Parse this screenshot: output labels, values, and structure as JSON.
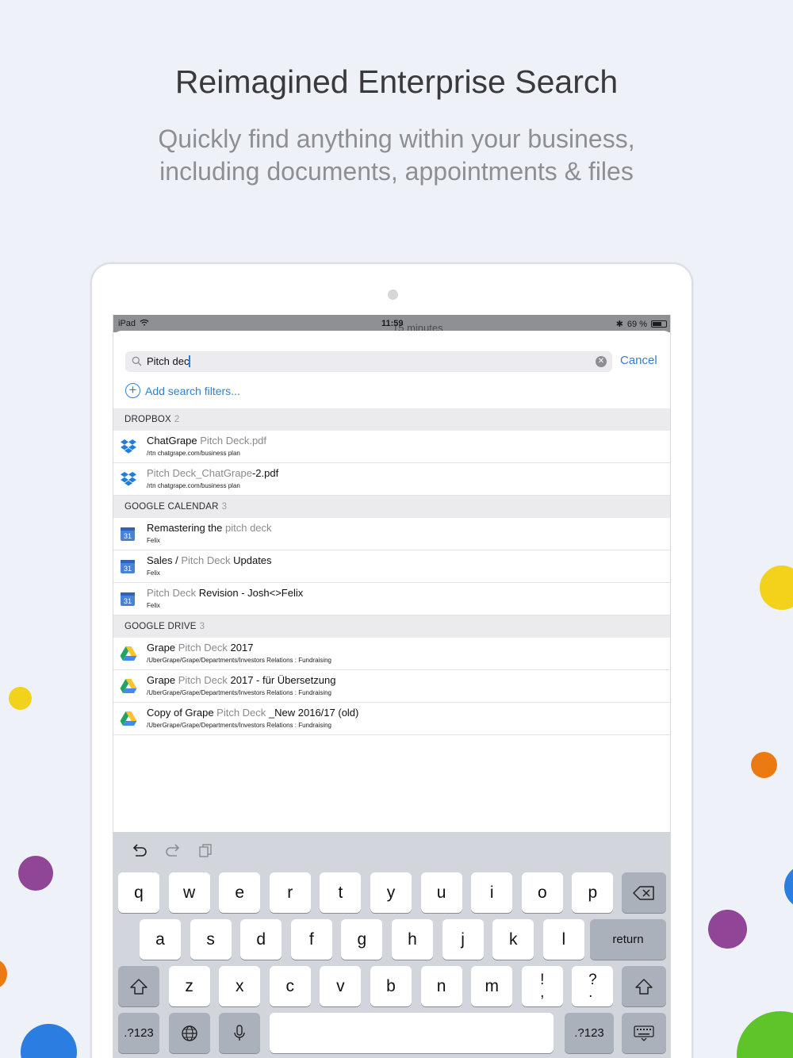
{
  "headline": "Reimagined Enterprise Search",
  "subline": [
    "Quickly find anything within your business,",
    "including documents, appointments & files"
  ],
  "colors": {
    "accent": "#2f7fd6",
    "dots": [
      "#f2d21b",
      "#f2d21b",
      "#ec7a12",
      "#914596",
      "#914596",
      "#2a7de1",
      "#5ec42a",
      "#ec7a12"
    ]
  },
  "status_bar": {
    "device": "iPad",
    "time": "11:59",
    "ghost_text": "15 minutes",
    "battery": "69 %",
    "battery_level": 0.69
  },
  "search": {
    "value": "Pitch dec",
    "cancel": "Cancel",
    "add_filters": "Add search filters..."
  },
  "sections": [
    {
      "name": "DROPBOX",
      "count": "2",
      "icon": "dropbox-icon",
      "items": [
        {
          "parts": [
            {
              "t": "ChatGrape "
            },
            {
              "t": "Pitch Deck.pdf",
              "hl": true
            }
          ],
          "sub": "/rtn chatgrape.com/business plan"
        },
        {
          "parts": [
            {
              "t": "Pitch Deck_ChatGrape",
              "hl": true
            },
            {
              "t": "-2.pdf"
            }
          ],
          "sub": "/rtn chatgrape.com/business plan"
        }
      ]
    },
    {
      "name": "GOOGLE CALENDAR",
      "count": "3",
      "icon": "calendar-icon",
      "items": [
        {
          "parts": [
            {
              "t": "Remastering the "
            },
            {
              "t": "pitch deck",
              "hl": true
            }
          ],
          "sub": "Felix"
        },
        {
          "parts": [
            {
              "t": "Sales / "
            },
            {
              "t": "Pitch Deck",
              "hl": true
            },
            {
              "t": " Updates"
            }
          ],
          "sub": "Felix"
        },
        {
          "parts": [
            {
              "t": "Pitch Deck",
              "hl": true
            },
            {
              "t": " Revision - Josh<>Felix"
            }
          ],
          "sub": "Felix"
        }
      ]
    },
    {
      "name": "GOOGLE DRIVE",
      "count": "3",
      "icon": "google-drive-icon",
      "items": [
        {
          "parts": [
            {
              "t": "Grape "
            },
            {
              "t": "Pitch Deck",
              "hl": true
            },
            {
              "t": " 2017"
            }
          ],
          "sub": "/UberGrape/Grape/Departments/Investors Relations : Fundraising"
        },
        {
          "parts": [
            {
              "t": "Grape "
            },
            {
              "t": "Pitch Deck",
              "hl": true
            },
            {
              "t": " 2017 - für Übersetzung"
            }
          ],
          "sub": "/UberGrape/Grape/Departments/Investors Relations : Fundraising"
        },
        {
          "parts": [
            {
              "t": "Copy of Grape "
            },
            {
              "t": "Pitch Deck",
              "hl": true
            },
            {
              "t": " _New 2016/17 (old)"
            }
          ],
          "sub": "/UberGrape/Grape/Departments/Investors Relations : Fundraising"
        }
      ]
    }
  ],
  "calendar_day": "31",
  "keyboard": {
    "row1": [
      "q",
      "w",
      "e",
      "r",
      "t",
      "y",
      "u",
      "i",
      "o",
      "p"
    ],
    "row2": [
      "a",
      "s",
      "d",
      "f",
      "g",
      "h",
      "j",
      "k",
      "l"
    ],
    "row3": [
      "z",
      "x",
      "c",
      "v",
      "b",
      "n",
      "m"
    ],
    "punct": [
      "!\n,",
      "?\n."
    ],
    "return": "return",
    "numbers": ".?123"
  }
}
